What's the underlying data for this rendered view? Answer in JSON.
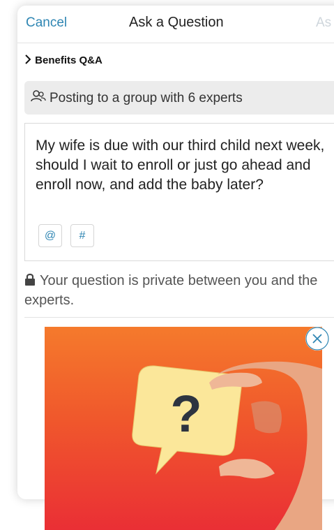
{
  "header": {
    "cancel_label": "Cancel",
    "title": "Ask a Question",
    "ask_label": "As"
  },
  "group": {
    "name": "Benefits Q&A",
    "expand_icon": "chevron-right-icon"
  },
  "posting": {
    "icon": "people-icon",
    "text": "Posting to a group with 6 experts"
  },
  "editor": {
    "question": "My wife is due with our third child next week, should I wait to enroll or just go ahead and enroll now, and add the baby later?",
    "mention_label": "@",
    "hashtag_label": "#"
  },
  "privacy": {
    "icon": "lock-icon",
    "text": "Your question is private between you and the experts."
  },
  "promo": {
    "image": "hand-holding-question-mark-bubble",
    "bubble_text": "?",
    "close_icon": "close-icon"
  },
  "colors": {
    "accent": "#2f86b3",
    "disabled": "#cfd6dc",
    "promo_top": "#f57a2c",
    "promo_bottom": "#ea2f35",
    "bubble": "#fbe79a"
  }
}
